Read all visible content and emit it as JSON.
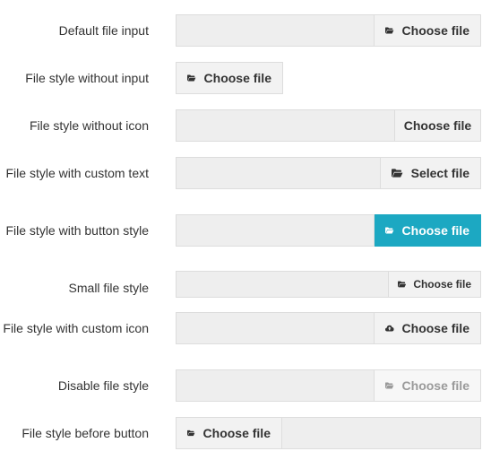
{
  "rows": [
    {
      "label": "Default file input",
      "button": "Choose file",
      "icon": "folder-open-icon"
    },
    {
      "label": "File style without input",
      "button": "Choose file",
      "icon": "folder-open-icon"
    },
    {
      "label": "File style without icon",
      "button": "Choose file"
    },
    {
      "label": "File style with custom text",
      "button": "Select file",
      "icon": "folder-open-icon"
    },
    {
      "label": "File style with button style",
      "button": "Choose file",
      "icon": "folder-open-icon",
      "accent": "#1ca8c2"
    },
    {
      "label": "Small file style",
      "button": "Choose file",
      "icon": "folder-open-icon"
    },
    {
      "label": "File style with custom icon",
      "button": "Choose file",
      "icon": "cloud-upload-icon"
    },
    {
      "label": "Disable file style",
      "button": "Choose file",
      "icon": "folder-open-icon",
      "disabled": true
    },
    {
      "label": "File style before button",
      "button": "Choose file",
      "icon": "folder-open-icon"
    }
  ]
}
